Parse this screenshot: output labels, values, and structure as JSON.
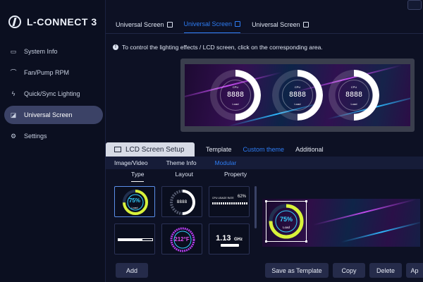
{
  "app": {
    "title": "L-CONNECT 3"
  },
  "sidebar": {
    "items": [
      {
        "label": "System Info",
        "icon": "monitor-icon"
      },
      {
        "label": "Fan/Pump RPM",
        "icon": "fan-icon"
      },
      {
        "label": "Quick/Sync Lighting",
        "icon": "lightning-icon"
      },
      {
        "label": "Universal Screen",
        "icon": "screen-icon"
      },
      {
        "label": "Settings",
        "icon": "gear-icon"
      }
    ],
    "active_index": 3
  },
  "top_tabs": [
    {
      "label": "Universal Screen"
    },
    {
      "label": "Universal Screen"
    },
    {
      "label": "Universal Screen"
    }
  ],
  "active_top_tab": 1,
  "hint": "To control the lighting effects / LCD screen, click on the corresponding area.",
  "lcd_preview": {
    "gauges": [
      {
        "value": "8888",
        "top": "CPU",
        "bottom": "Load"
      },
      {
        "value": "8888",
        "top": "CPU",
        "bottom": "Load"
      },
      {
        "value": "8888",
        "top": "CPU",
        "bottom": "Load"
      }
    ]
  },
  "setup": {
    "tab_label": "LCD Screen Setup",
    "subtabs": [
      "Template",
      "Custom theme",
      "Additional"
    ],
    "active_subtab": 1
  },
  "subbar": {
    "items": [
      "Image/Video",
      "Theme Info",
      "Modular"
    ],
    "active": 2
  },
  "typebar": {
    "items": [
      "Type",
      "Layout",
      "Property"
    ],
    "active": 0
  },
  "modules": {
    "tile1": {
      "value": "75%",
      "label": "Load"
    },
    "tile2": {
      "value": "8888"
    },
    "tile3": {
      "label": "CPU USAGE RATE",
      "value": "62%"
    },
    "tile5": {
      "value": "212°F"
    },
    "tile6": {
      "value": "1.13",
      "unit": "GHz"
    }
  },
  "preview": {
    "value": "75%",
    "label": "Load"
  },
  "buttons": {
    "add": "Add",
    "save_template": "Save as Template",
    "copy": "Copy",
    "delete": "Delete",
    "apply": "Ap"
  },
  "colors": {
    "accent": "#2e7df4",
    "ring_yellow": "#d9f23a",
    "ring_cyan": "#35d0ff"
  }
}
